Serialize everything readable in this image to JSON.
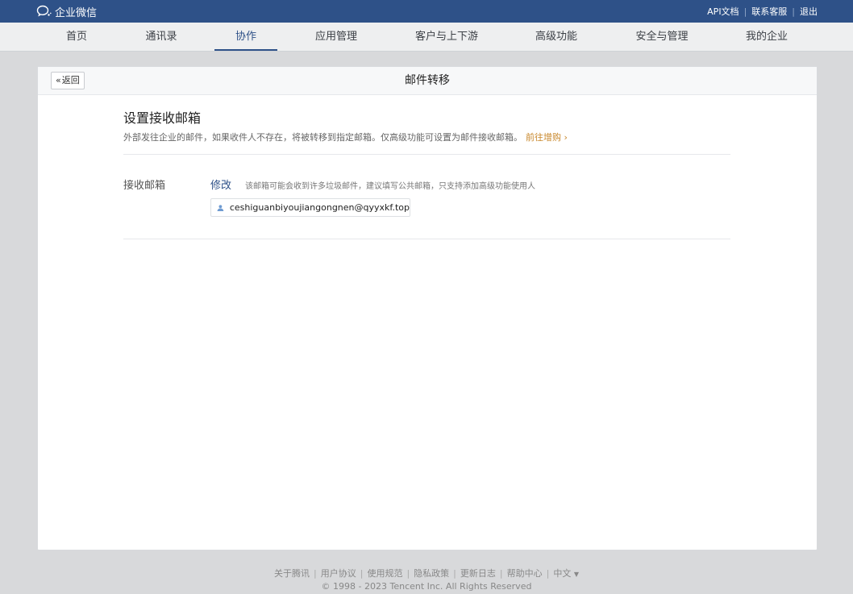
{
  "topbar": {
    "brand": "企业微信",
    "links": [
      "API文档",
      "联系客服",
      "退出"
    ]
  },
  "nav": {
    "items": [
      {
        "label": "首页"
      },
      {
        "label": "通讯录"
      },
      {
        "label": "协作",
        "active": true
      },
      {
        "label": "应用管理"
      },
      {
        "label": "客户与上下游"
      },
      {
        "label": "高级功能"
      },
      {
        "label": "安全与管理"
      },
      {
        "label": "我的企业"
      }
    ]
  },
  "page": {
    "back_label": "返回",
    "title": "邮件转移"
  },
  "section": {
    "title": "设置接收邮箱",
    "description": "外部发往企业的邮件，如果收件人不存在，将被转移到指定邮箱。仅高级功能可设置为邮件接收邮箱。",
    "upgrade_link": "前往增购"
  },
  "field": {
    "label": "接收邮箱",
    "edit_label": "修改",
    "hint": "该邮箱可能会收到许多垃圾邮件，建议填写公共邮箱，只支持添加高级功能使用人",
    "email": "ceshiguanbiyoujiangongnen@qyyxkf.top"
  },
  "footer": {
    "links": [
      "关于腾讯",
      "用户协议",
      "使用规范",
      "隐私政策",
      "更新日志",
      "帮助中心"
    ],
    "language": "中文",
    "copyright": "© 1998 - 2023 Tencent Inc. All Rights Reserved"
  },
  "colors": {
    "brand": "#2e5188",
    "link_orange": "#c8872b"
  }
}
